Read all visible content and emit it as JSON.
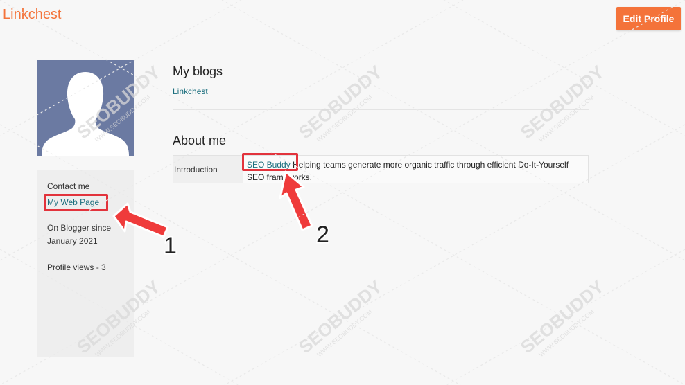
{
  "header": {
    "brand": "Linkchest",
    "edit_button_label": "Edit Profile"
  },
  "sidebar": {
    "contact_label": "Contact me",
    "web_page_link": "My Web Page",
    "blogger_since_label": "On Blogger since",
    "blogger_since_date": "January 2021",
    "profile_views": "Profile views - 3"
  },
  "main": {
    "blogs_heading": "My blogs",
    "blog_link": "Linkchest",
    "about_heading": "About me",
    "intro_label": "Introduction",
    "intro_link": "SEO Buddy",
    "intro_text": " Helping teams generate more organic traffic through efficient Do-It-Yourself SEO frameworks."
  },
  "annotations": {
    "arrow_1_label": "1",
    "arrow_2_label": "2"
  },
  "watermark": {
    "text": "SEOBUDDY",
    "subtext": "WWW.SEOBUDDY.COM"
  },
  "colors": {
    "accent": "#f4733a",
    "link": "#1a6e7d",
    "highlight": "#e2333c",
    "avatar_bg": "#6b7aa2"
  }
}
